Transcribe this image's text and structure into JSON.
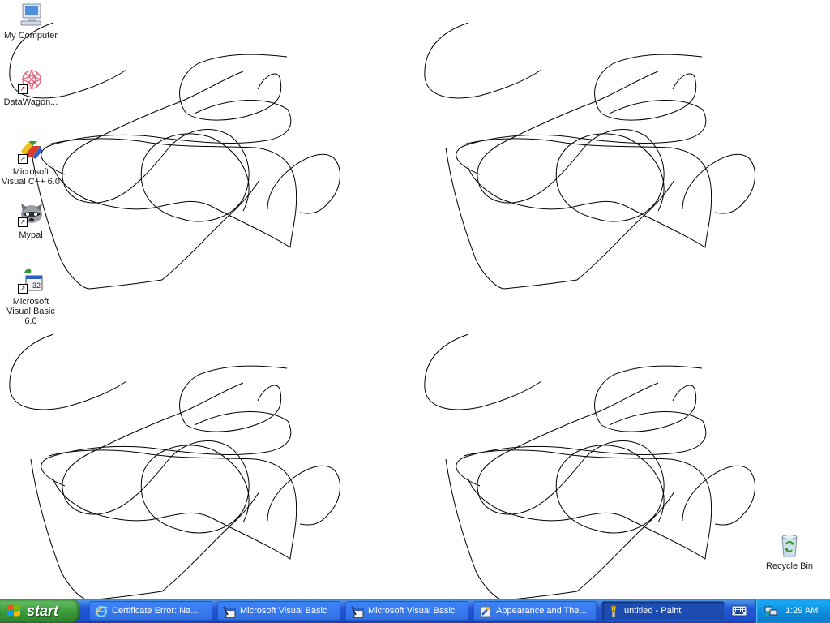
{
  "desktop": {
    "icons": [
      {
        "label": "My Computer",
        "icon": "my-computer-icon"
      },
      {
        "label": "DataWagon...",
        "icon": "datawagon-icon"
      },
      {
        "label": "Microsoft Visual C++ 6.0",
        "icon": "visual-cpp-icon"
      },
      {
        "label": "Mypal",
        "icon": "mypal-icon"
      },
      {
        "label": "Microsoft Visual Basic 6.0",
        "icon": "visual-basic-icon"
      },
      {
        "label": "Recycle Bin",
        "icon": "recycle-bin-icon"
      }
    ],
    "drawing": {
      "stroke_color": "#000000",
      "copies": 4
    }
  },
  "taskbar": {
    "start_label": "start",
    "tasks": [
      {
        "label": "Certificate Error: Na...",
        "icon": "internet-explorer-icon",
        "active": false
      },
      {
        "label": "Microsoft Visual Basic",
        "icon": "visual-basic-icon",
        "active": false
      },
      {
        "label": "Microsoft Visual Basic",
        "icon": "visual-basic-icon",
        "active": false
      },
      {
        "label": "Appearance and The...",
        "icon": "control-panel-icon",
        "active": false
      },
      {
        "label": "untitled - Paint",
        "icon": "paint-icon",
        "active": true
      }
    ],
    "language_icon": "keyboard-language-icon",
    "tray_icon": "network-icon",
    "clock": "1:29 AM",
    "colors": {
      "taskbar": "#245edb",
      "start": "#3c9a3c",
      "tray": "#0f97e6"
    }
  }
}
